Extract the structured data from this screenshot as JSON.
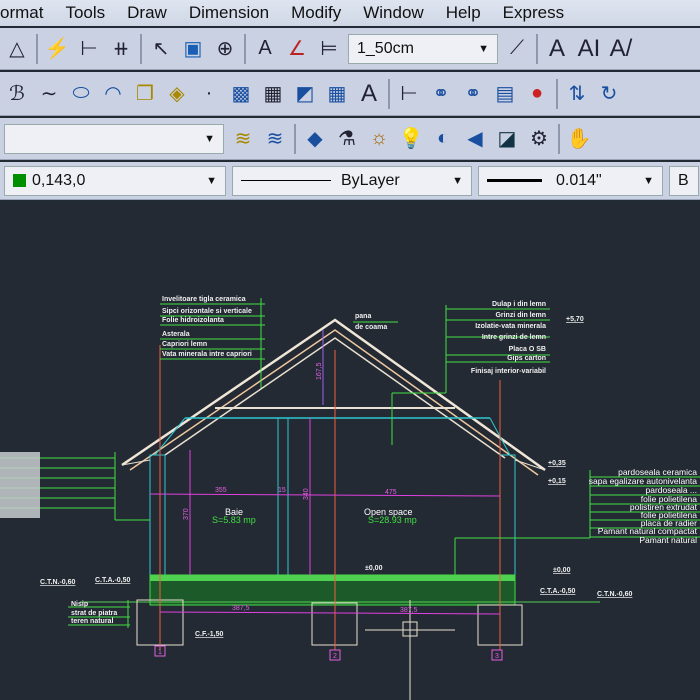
{
  "menu": [
    "ormat",
    "Tools",
    "Draw",
    "Dimension",
    "Modify",
    "Window",
    "Help",
    "Express"
  ],
  "toolbar": {
    "dimstyle": "1_50cm",
    "color": "0,143,0",
    "linetype": "ByLayer",
    "lineweight": "0.014\"",
    "layer": "",
    "partial": "B"
  },
  "drawing": {
    "left_labels": [
      "Invelitoare tigla ceramica",
      "Sipci orizontale si verticale",
      "Folie hidroizolanta",
      "Asterala",
      "Capriori lemn",
      "Vata minerala intre capriori"
    ],
    "ridge_label": [
      "pana",
      "de coama"
    ],
    "right_labels": [
      "Dulap i din lemn",
      "Grinzi din lemn",
      "Izolatie-vata minerala",
      "Intre grinzi de lemn",
      "Placa O SB",
      "Gips carton",
      "Finisaj interior-variabil"
    ],
    "level_top": "+5,70",
    "floor_labels": [
      "pardoseala ceramica",
      "sapa egalizare autonivelanta",
      "pardoseala ...",
      "folie polietilena",
      "polistiren extrudat",
      "folie polietilena",
      "placa de radier",
      "Pamant natural compactat",
      "Pamant natural"
    ],
    "levels": {
      "a": "+0,35",
      "b": "+0,15",
      "zero": "±0,00",
      "zero2": "±0,00",
      "ctn_left": "C.T.N.-0,60",
      "cta_left": "C.T.A.-0,50",
      "cta_right": "C.T.A.-0,50",
      "ctn_right": "C.T.N.-0,60",
      "cf": "C.F.-1,50"
    },
    "foundation_labels": [
      "Nisip",
      "strat de piatra",
      "teren natural"
    ],
    "rooms": [
      {
        "name": "Baie",
        "area": "S=5.83 mp"
      },
      {
        "name": "Open space",
        "area": "S=28.93 mp"
      }
    ],
    "dims": {
      "d1": "355",
      "d2": "15",
      "d3": "475",
      "h1": "370",
      "h2": "340",
      "h3": "167,5",
      "b1": "387,5",
      "b2": "387,5"
    },
    "axes": [
      "1",
      "2",
      "3"
    ]
  }
}
